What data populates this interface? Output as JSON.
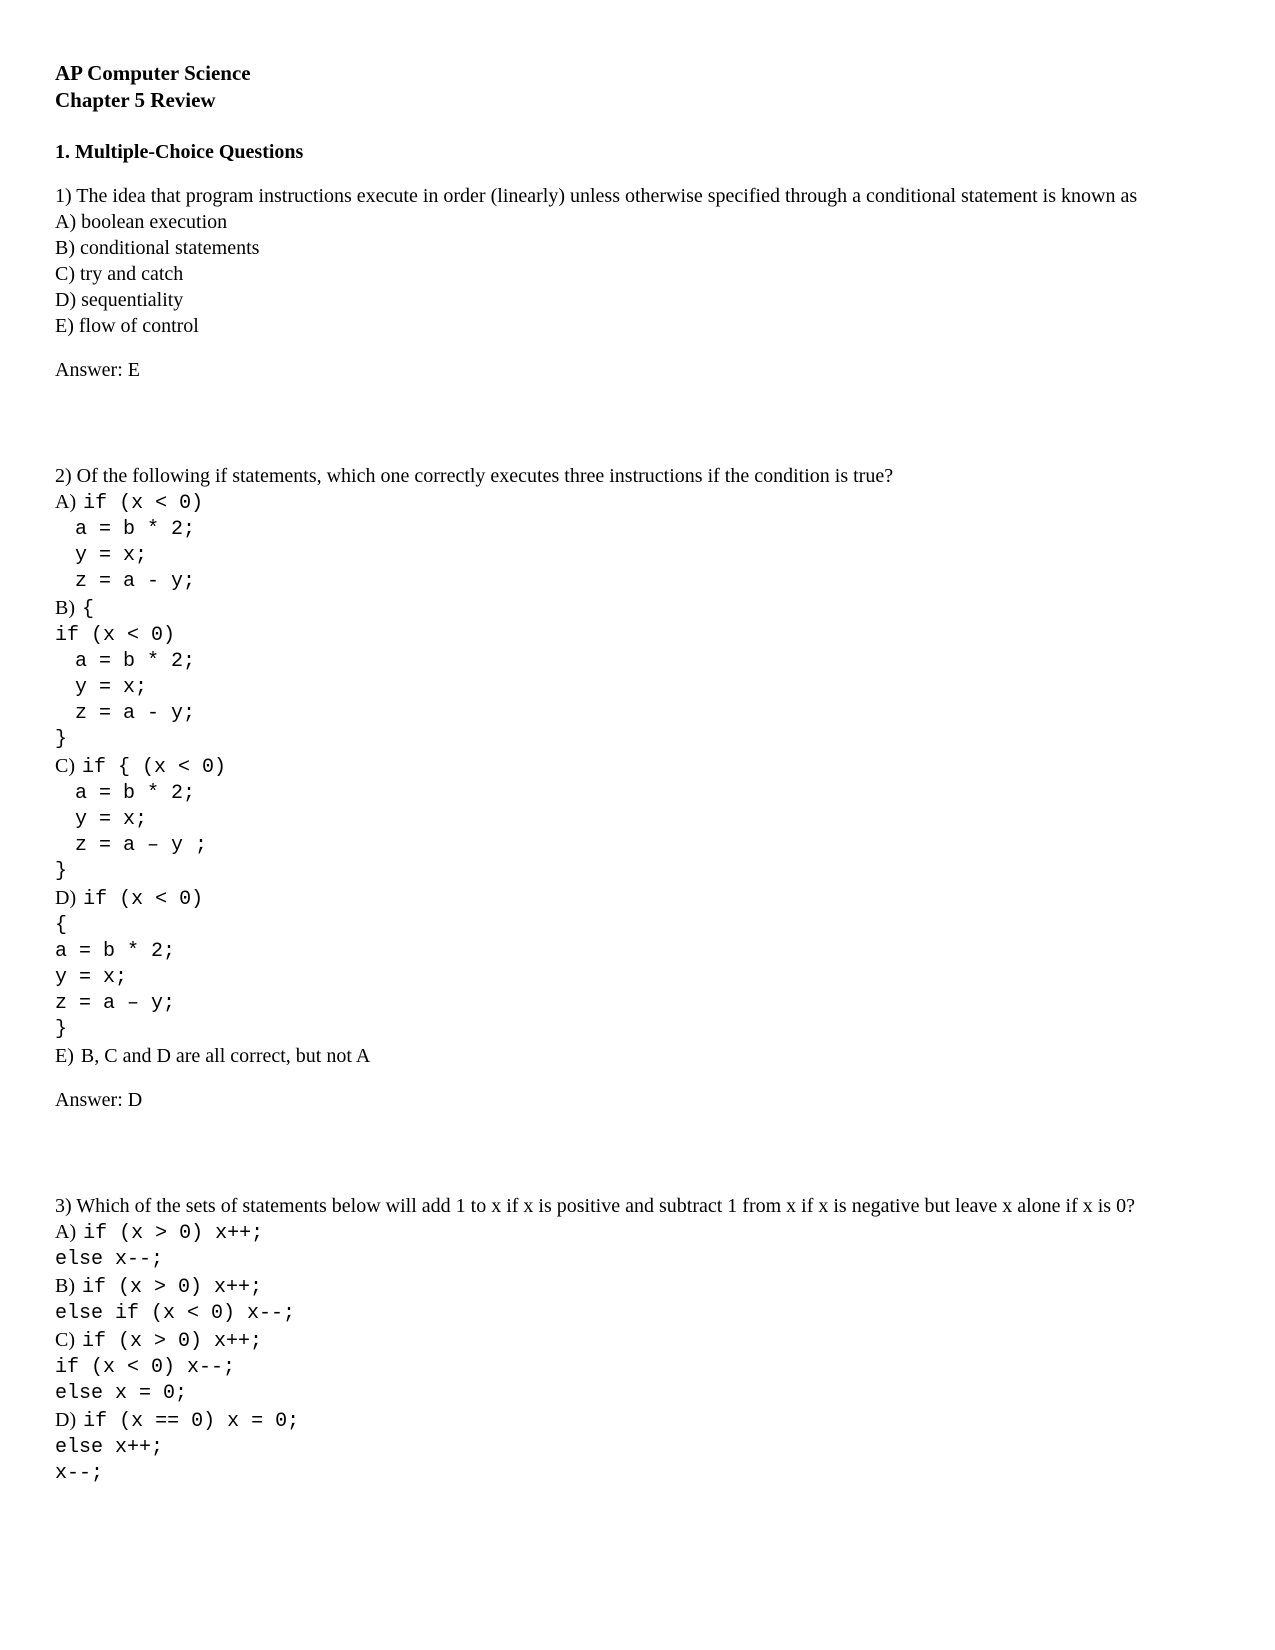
{
  "header": {
    "title1": "AP Computer Science",
    "title2": "Chapter 5 Review"
  },
  "section1_heading": "1.  Multiple-Choice Questions",
  "q1": {
    "prompt": "1) The idea that program instructions execute in order (linearly) unless otherwise specified through a conditional statement is known as",
    "optA": "A) boolean execution",
    "optB": "B) conditional statements",
    "optC": "C) try and catch",
    "optD": "D) sequentiality",
    "optE": "E) flow of control",
    "answer": "Answer:  E"
  },
  "q2": {
    "prompt": "2) Of the following if statements, which one correctly executes three instructions if the condition is true?",
    "A_label": "A) ",
    "A_l1": "if (x < 0)",
    "A_l2": " a = b * 2;",
    "A_l3": " y = x;",
    "A_l4": " z = a - y;",
    "B_label": "B) ",
    "B_l1": "    {",
    "B_l2": "if (x < 0)",
    "B_l3": " a = b * 2;",
    "B_l4": " y = x;",
    "B_l5": " z = a - y;",
    "B_l6": "}",
    "C_label": "C) ",
    "C_l1": "if { (x < 0)",
    "C_l2": " a = b * 2;",
    "C_l3": " y = x;",
    "C_l4": " z = a – y ;",
    "C_l5": "}",
    "D_label": "D) ",
    "D_l1": "if (x < 0)",
    "D_l2": "{",
    "D_l3": "a = b * 2;",
    "D_l4": "y = x;",
    "D_l5": "z = a – y;",
    "D_l6": "}",
    "E_label": "E) ",
    "E_text": " B, C and D are all correct, but not A",
    "answer": "Answer:  D"
  },
  "q3": {
    "prompt": "3) Which of the sets of statements below will add 1 to x if x is positive and subtract 1 from x if x is negative but leave x alone if x is 0?",
    "A_label": "A) ",
    "A_l1": "if (x > 0) x++;",
    "A_l2": "else x--;",
    "B_label": "B) ",
    "B_l1": "if (x > 0) x++;",
    "B_l2": "else if (x < 0) x--;",
    "C_label": "C) ",
    "C_l1": "if (x > 0) x++;",
    "C_l2": "if (x < 0) x--;",
    "C_l3": "else x = 0;",
    "D_label": "D) ",
    "D_l1": "if (x == 0) x = 0;",
    "D_l2": "else x++;",
    "D_l3": "x--;"
  }
}
